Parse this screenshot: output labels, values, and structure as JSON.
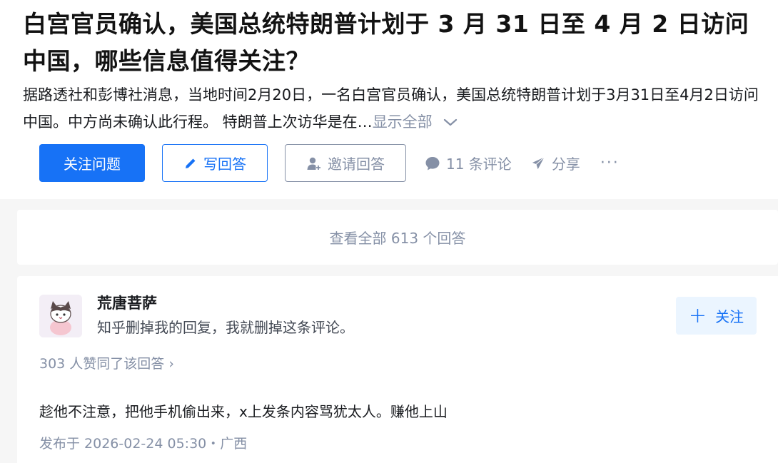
{
  "question": {
    "title": "白宫官员确认，美国总统特朗普计划于 3 月 31 日至 4 月 2 日访问中国，哪些信息值得关注？",
    "excerpt": "据路透社和彭博社消息，当地时间2月20日，一名白宫官员确认，美国总统特朗普计划于3月31日至4月2日访问中国。中方尚未确认此行程。 特朗普上次访华是在…",
    "show_all": "显示全部"
  },
  "actions": {
    "follow_question": "关注问题",
    "write_answer": "写回答",
    "invite_answer": "邀请回答",
    "comments": "11 条评论",
    "share": "分享",
    "more": "···"
  },
  "answers_summary": {
    "view_all": "查看全部 613 个回答"
  },
  "answer": {
    "author_name": "荒唐菩萨",
    "author_bio": "知乎删掉我的回复，我就删掉这条评论。",
    "follow_label": "关注",
    "upvotes": "303 人赞同了该回答 ›",
    "content": "趁他不注意，把他手机偷出来，x上发条内容骂犹太人。赚他上山",
    "published": "发布于 2026-02-24 05:30・广西"
  },
  "colors": {
    "brand_blue": "#1772f6",
    "muted_gray": "#8590a6",
    "follow_bg": "#ebf5ff",
    "page_bg": "#f6f6f6"
  },
  "icons": [
    "pencil-icon",
    "invite-user-icon",
    "comment-bubble-icon",
    "share-plane-icon",
    "chevron-down-icon",
    "plus-icon"
  ]
}
